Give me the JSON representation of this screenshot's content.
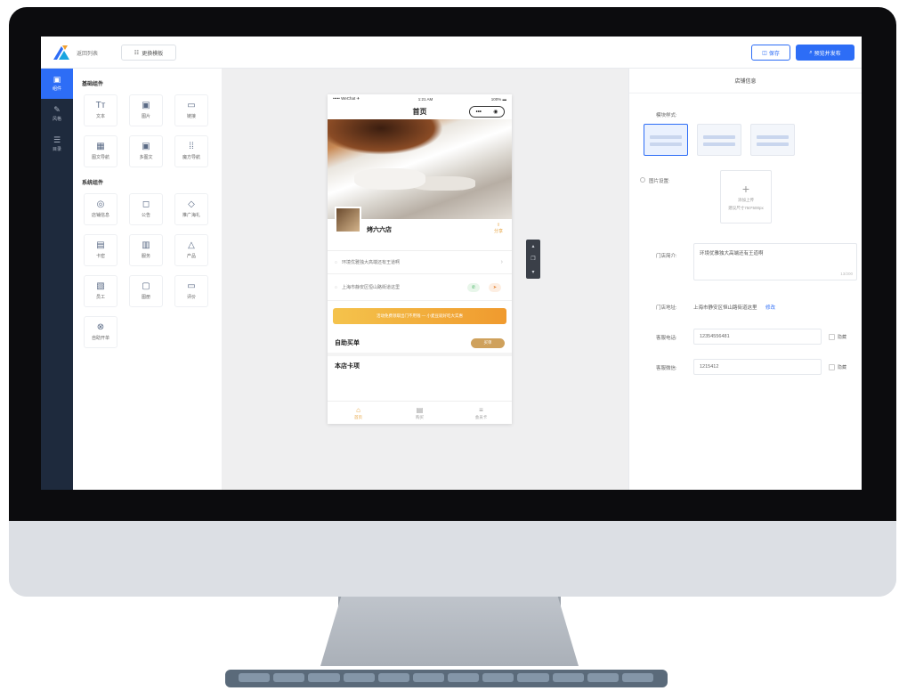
{
  "topbar": {
    "back_label": "返回列表",
    "template_label": "更换模板",
    "save_label": "保存",
    "publish_label": "预览并发布"
  },
  "rail": {
    "items": [
      {
        "label": "组件",
        "icon": "grid-icon"
      },
      {
        "label": "风格",
        "icon": "brush-icon"
      },
      {
        "label": "目录",
        "icon": "list-icon"
      }
    ]
  },
  "components": {
    "basic_title": "基础组件",
    "basic": [
      {
        "label": "文本",
        "icon": "Tт"
      },
      {
        "label": "图片",
        "icon": "▣"
      },
      {
        "label": "链接",
        "icon": "▭"
      },
      {
        "label": "图文导航",
        "icon": "▦"
      },
      {
        "label": "多图文",
        "icon": "▣"
      },
      {
        "label": "魔方导航",
        "icon": "⁞⁞"
      }
    ],
    "system_title": "系统组件",
    "system": [
      {
        "label": "店铺信息",
        "icon": "◎"
      },
      {
        "label": "公告",
        "icon": "◻"
      },
      {
        "label": "推广海礼",
        "icon": "◇"
      },
      {
        "label": "卡密",
        "icon": "▤"
      },
      {
        "label": "服务",
        "icon": "▥"
      },
      {
        "label": "产品",
        "icon": "△"
      },
      {
        "label": "员工",
        "icon": "▧"
      },
      {
        "label": "图册",
        "icon": "▢"
      },
      {
        "label": "评价",
        "icon": "▭"
      },
      {
        "label": "自助开单",
        "icon": "⊗"
      }
    ]
  },
  "phone": {
    "carrier": "••••• WeChat ✈",
    "time": "1:21 AM",
    "battery": "100% ▬",
    "title": "首页",
    "capsule_dots": "•••",
    "capsule_target": "◉",
    "store_name": "烤六六店",
    "share": "分享",
    "intro": "环境优雅独大高端还有王道啊",
    "address": "上海市静安区恒山路街道这里",
    "banner": "活动免费领取出门不用钱 — 小麦豆就好吃大实惠",
    "self_menu": "自助买单",
    "menu_btn": "买单",
    "cards": "本店卡项",
    "tabs": [
      {
        "label": "首页",
        "icon": "⌂"
      },
      {
        "label": "购买",
        "icon": "▤"
      },
      {
        "label": "会员卡",
        "icon": "≡"
      }
    ]
  },
  "props": {
    "title": "店铺信息",
    "style_label": "模块样式:",
    "image_label": "图片设置:",
    "upload_label": "添加上传",
    "upload_hint": "建议尺寸750*500px",
    "intro_label": "门店简介:",
    "intro_value": "环境优雅独大高端还有王道啊",
    "intro_count": "13/200",
    "address_label": "门店地址:",
    "address_value": "上海市静安区恒山路街道这里",
    "address_edit": "修改",
    "phone_label": "客服电话:",
    "phone_value": "12354556481",
    "wechat_label": "客服微信:",
    "wechat_value": "1215412",
    "hide_label": "隐藏"
  },
  "colors": {
    "accent": "#2d6df6",
    "rail": "#1e2a3d",
    "orange": "#e6a23c"
  }
}
